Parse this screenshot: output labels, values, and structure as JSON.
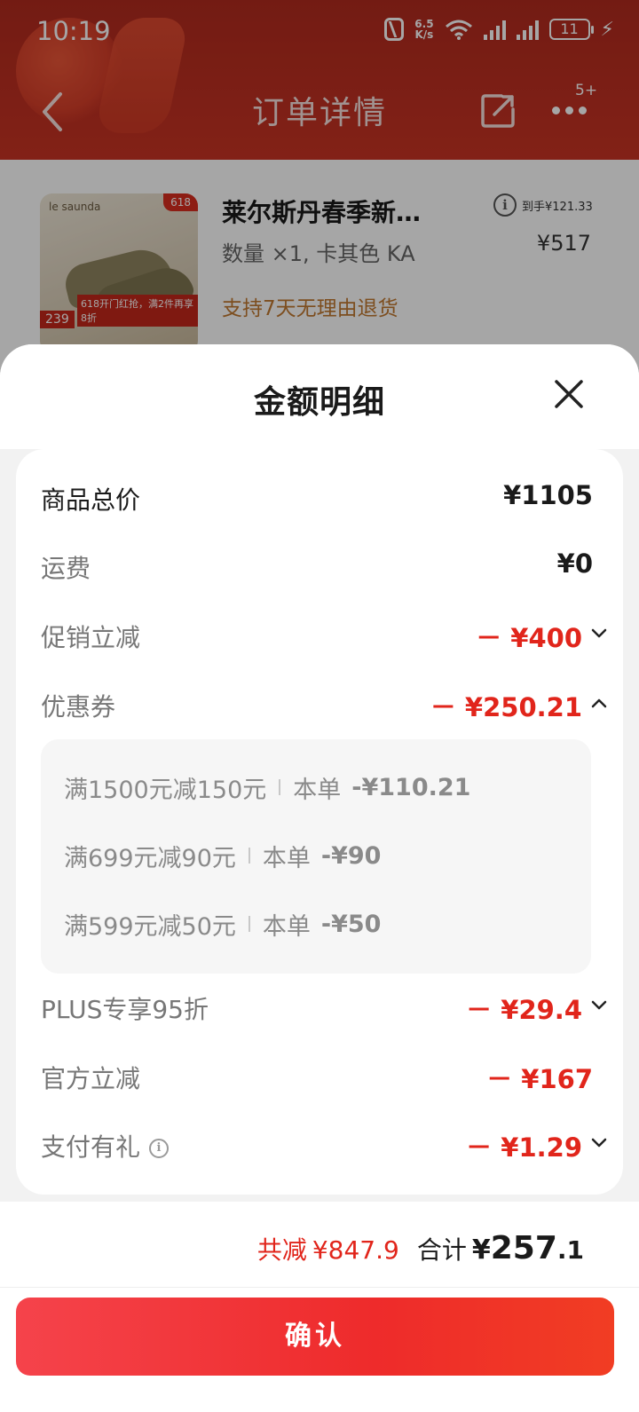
{
  "status_bar": {
    "time": "10:19",
    "net_speed_value": "6.5",
    "net_speed_unit": "K/s",
    "battery": "11"
  },
  "nav": {
    "title": "订单详情",
    "more_badge": "5+"
  },
  "product": {
    "name": "莱尔斯丹春季新…",
    "spec": "数量 ×1, 卡其色 KA",
    "return_policy": "支持7天无理由退货",
    "est_price": "到手¥121.33",
    "price": "¥517",
    "image_brand": "le saunda",
    "image_tag": "618",
    "image_promo": "618开门红抢，满2件再享8折",
    "image_price": "239"
  },
  "sheet": {
    "title": "金额明细",
    "rows": [
      {
        "label": "商品总价",
        "value": "¥1105"
      },
      {
        "label": "运费",
        "value": "¥0"
      },
      {
        "label": "促销立减",
        "value": "－ ¥400"
      },
      {
        "label": "优惠券",
        "value": "－ ¥250.21"
      },
      {
        "label": "PLUS专享95折",
        "value": "－ ¥29.4"
      },
      {
        "label": "官方立减",
        "value": "－ ¥167"
      },
      {
        "label": "支付有礼",
        "value": "－ ¥1.29"
      }
    ],
    "coupons": [
      {
        "rule": "满1500元减150元",
        "scope": "本单",
        "amount": "-¥110.21"
      },
      {
        "rule": "满699元减90元",
        "scope": "本单",
        "amount": "-¥90"
      },
      {
        "rule": "满599元减50元",
        "scope": "本单",
        "amount": "-¥50"
      }
    ]
  },
  "footer": {
    "save_label": "共减",
    "save_amount": "¥847.9",
    "total_label": "合计",
    "total_currency": "¥",
    "total_int": "257",
    "total_dec": ".1",
    "confirm_label": "确认"
  },
  "colors": {
    "accent": "#e1251b",
    "header_bg": "#c93424",
    "muted_text": "#777777"
  }
}
